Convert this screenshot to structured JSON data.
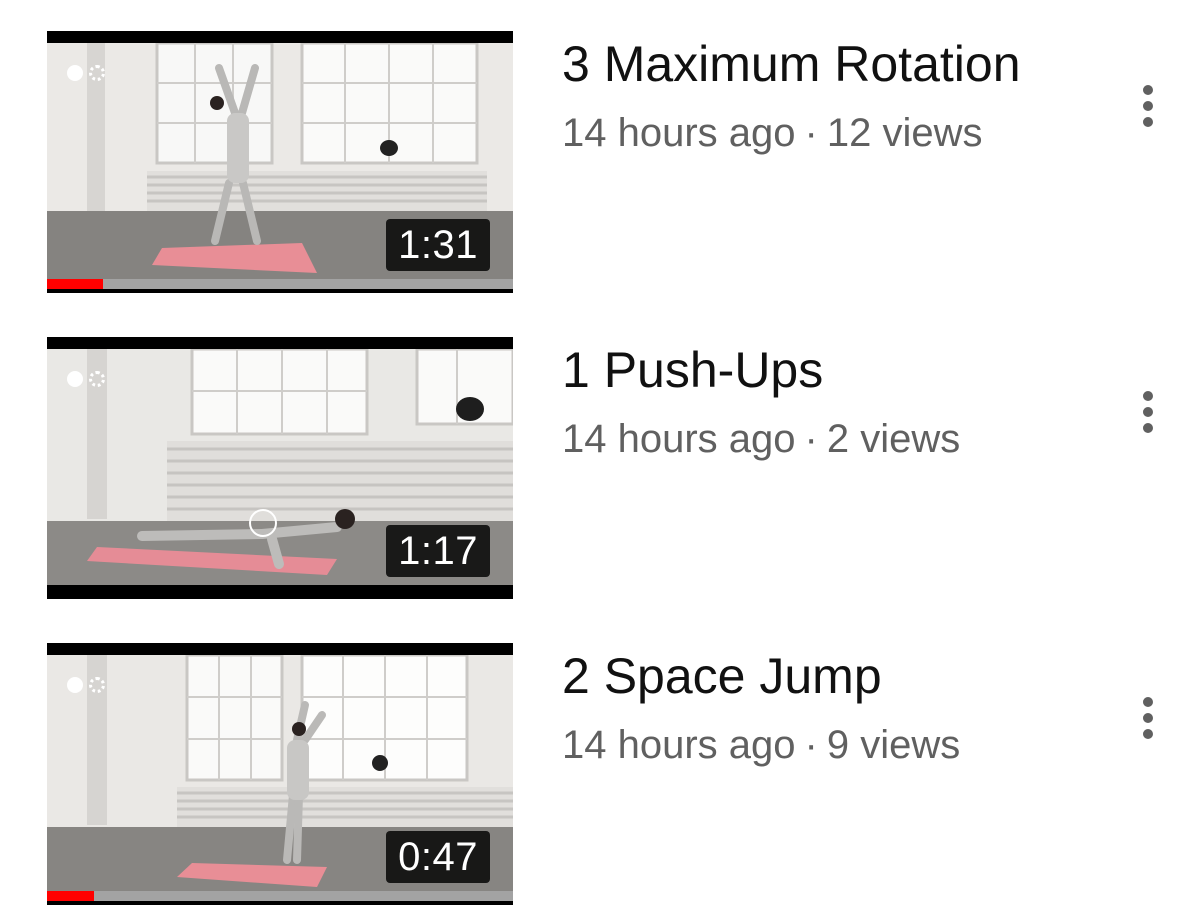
{
  "videos": [
    {
      "title": "3 Maximum Rotation",
      "age": "14 hours ago",
      "separator": "·",
      "views": "12 views",
      "duration": "1:31",
      "progress": 0.12,
      "progress_color": "#ff0000"
    },
    {
      "title": "1 Push-Ups",
      "age": "14 hours ago",
      "separator": "·",
      "views": "2 views",
      "duration": "1:17",
      "progress": 0,
      "progress_color": "#ff0000"
    },
    {
      "title": "2 Space Jump",
      "age": "14 hours ago",
      "separator": "·",
      "views": "9 views",
      "duration": "0:47",
      "progress": 0.1,
      "progress_color": "#ff0000"
    }
  ],
  "icons": {
    "menu": "more-vert-icon",
    "camera": "camera-mode-icon"
  }
}
